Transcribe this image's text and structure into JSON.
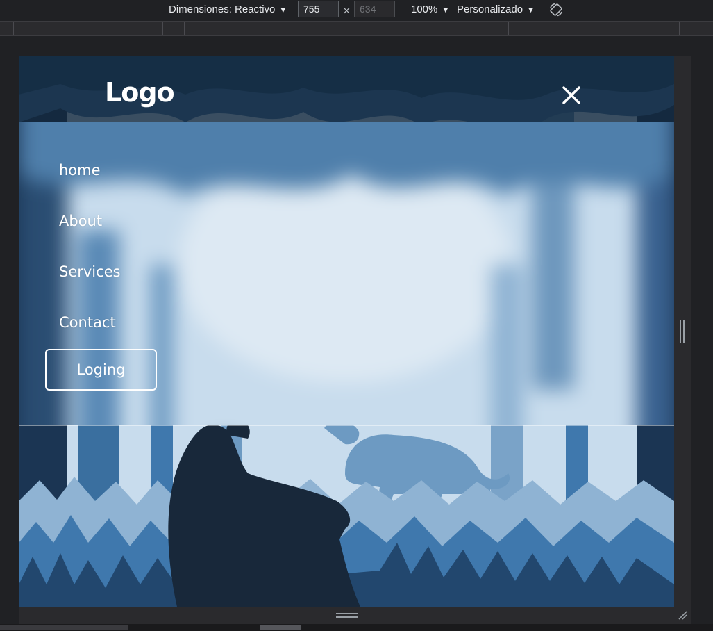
{
  "devtools": {
    "dimensions_label": "Dimensiones: Reactivo",
    "width_value": "755",
    "height_value": "634",
    "times_symbol": "×",
    "zoom_label": "100%",
    "throttle_label": "Personalizado",
    "caret": "▼",
    "icons": {
      "rotate": "rotate-icon",
      "resize": "resize-grip-icon"
    }
  },
  "site": {
    "logo": "Logo",
    "close_icon": "close-icon",
    "menu": [
      {
        "label": "home"
      },
      {
        "label": "About"
      },
      {
        "label": "Services"
      },
      {
        "label": "Contact"
      }
    ],
    "login_label": "Loging"
  },
  "colors": {
    "header_bg": "#12263a",
    "sky": "#c8dced",
    "tree_dark": "#1b3553",
    "tree_mid": "#3a6f9f",
    "panther": "#18283a",
    "background_panther": "#6d9ac2"
  }
}
